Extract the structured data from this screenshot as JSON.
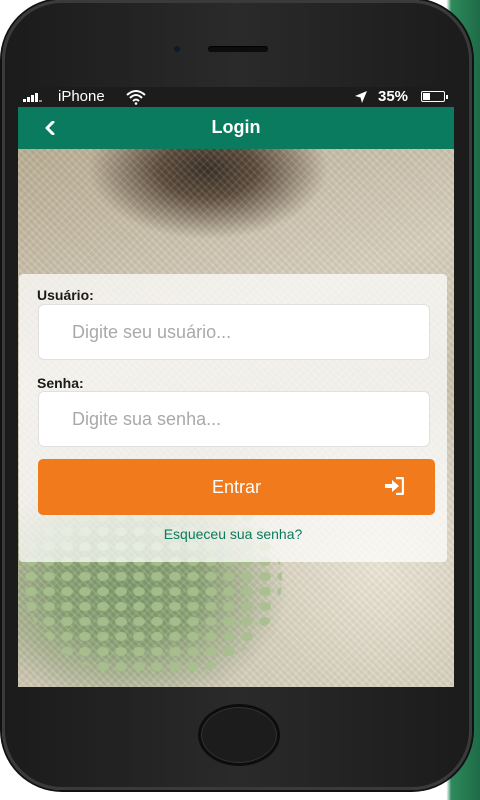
{
  "status_bar": {
    "carrier": "iPhone",
    "battery_percent": "35%",
    "battery_level": 0.35,
    "icons": [
      "signal-icon",
      "wifi-icon",
      "location-icon",
      "battery-icon"
    ]
  },
  "header": {
    "title": "Login",
    "back_icon": "chevron-left-icon",
    "background_color": "#0a7b5e"
  },
  "form": {
    "username": {
      "label": "Usuário:",
      "placeholder": "Digite seu usuário...",
      "value": ""
    },
    "password": {
      "label": "Senha:",
      "placeholder": "Digite sua senha...",
      "value": ""
    },
    "submit": {
      "label": "Entrar",
      "icon": "sign-in-icon",
      "color": "#f07a1c"
    },
    "forgot_password": "Esqueceu sua senha?"
  },
  "colors": {
    "accent": "#0a7b5e",
    "button": "#f07a1c"
  }
}
